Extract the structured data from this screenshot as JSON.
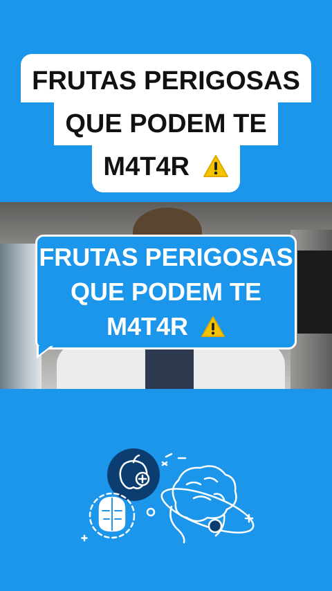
{
  "top_caption": {
    "lines": [
      "FRUTAS PERIGOSAS",
      "QUE PODEM TE",
      "M4T4R"
    ]
  },
  "overlay_caption": {
    "lines": [
      "FRUTAS PERIGOSAS",
      "QUE PODEM TE",
      "M4T4R"
    ]
  },
  "icons": {
    "warning": "warning-icon",
    "illustration": "brain-fruit-health-illustration"
  },
  "colors": {
    "background": "#1c96eb",
    "caption_box": "#ffffff",
    "warning": "#f5c400"
  }
}
